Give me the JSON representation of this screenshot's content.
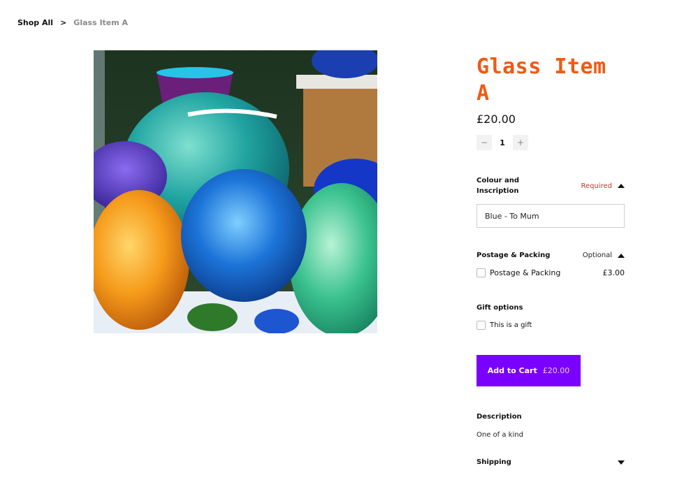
{
  "breadcrumb": {
    "shop_all": "Shop All",
    "separator": ">",
    "current": "Glass Item A"
  },
  "product": {
    "image_alt": "Colourful hand-blown glass vases and paperweights",
    "title": "Glass Item A",
    "price": "£20.00",
    "quantity": "1",
    "qty_minus": "−",
    "qty_plus": "+"
  },
  "options": {
    "colour": {
      "label": "Colour and Inscription",
      "status": "Required",
      "value": "Blue - To Mum"
    },
    "postage": {
      "label": "Postage & Packing",
      "status": "Optional",
      "choice_label": "Postage & Packing",
      "choice_price": "£3.00"
    },
    "gift": {
      "label": "Gift options",
      "choice_label": "This is a gift"
    }
  },
  "cart": {
    "label": "Add to Cart",
    "price": "£20.00"
  },
  "description": {
    "title": "Description",
    "body": "One of a kind"
  },
  "shipping": {
    "title": "Shipping"
  },
  "colors": {
    "title_accent": "#f05a12",
    "cart_button": "#7a00ff",
    "required": "#c0392b"
  }
}
